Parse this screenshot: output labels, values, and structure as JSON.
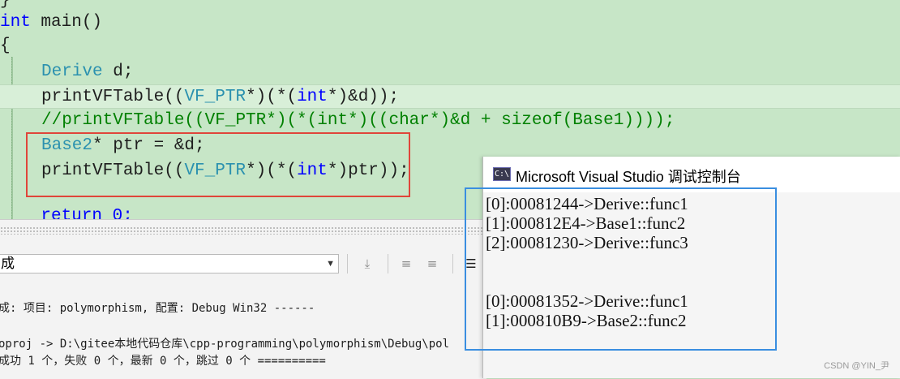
{
  "editor": {
    "lines": {
      "brace_close_prev": "}",
      "main_kw": "int",
      "main_rest": " main()",
      "brace_open": "{",
      "l1_type": "Derive",
      "l1_rest": " d;",
      "l2_a": "printVFTable((",
      "l2_type": "VF_PTR",
      "l2_b": "*)(*(",
      "l2_kw": "int",
      "l2_c": "*)&d));",
      "l3_comment": "//printVFTable((VF_PTR*)(*(int*)((char*)&d + sizeof(Base1))));",
      "l4_type": "Base2",
      "l4_rest": "* ptr = &d;",
      "l5_a": "printVFTable((",
      "l5_type": "VF_PTR",
      "l5_b": "*)(*(",
      "l5_kw": "int",
      "l5_c": "*)ptr));",
      "l6_partial": "    return 0;"
    }
  },
  "output_panel": {
    "source_selected": "成",
    "lines": [
      "成: 项目: polymorphism, 配置: Debug Win32 ------",
      "",
      "oproj -> D:\\gitee本地代码仓库\\cpp-programming\\polymorphism\\Debug\\pol",
      "成功 1 个，失败 0 个，最新 0 个，跳过 0 个 =========="
    ],
    "toolbar_icons": [
      "find-icon",
      "align-left-icon",
      "align-right-icon",
      "wrap-icon"
    ]
  },
  "console": {
    "icon_text": "C:\\",
    "title": "Microsoft Visual Studio 调试控制台",
    "lines": [
      "[0]:00081244->Derive::func1",
      "[1]:000812E4->Base1::func2",
      "[2]:00081230->Derive::func3",
      "",
      "",
      "[0]:00081352->Derive::func1",
      "[1]:000810B9->Base2::func2"
    ]
  },
  "watermark": "CSDN @YIN_尹",
  "colors": {
    "editor_bg": "#c7e6c7",
    "keyword": "#0000ff",
    "type": "#2b91af",
    "comment": "#008000",
    "red_highlight": "#e0453a",
    "blue_highlight": "#3a8ee0"
  }
}
